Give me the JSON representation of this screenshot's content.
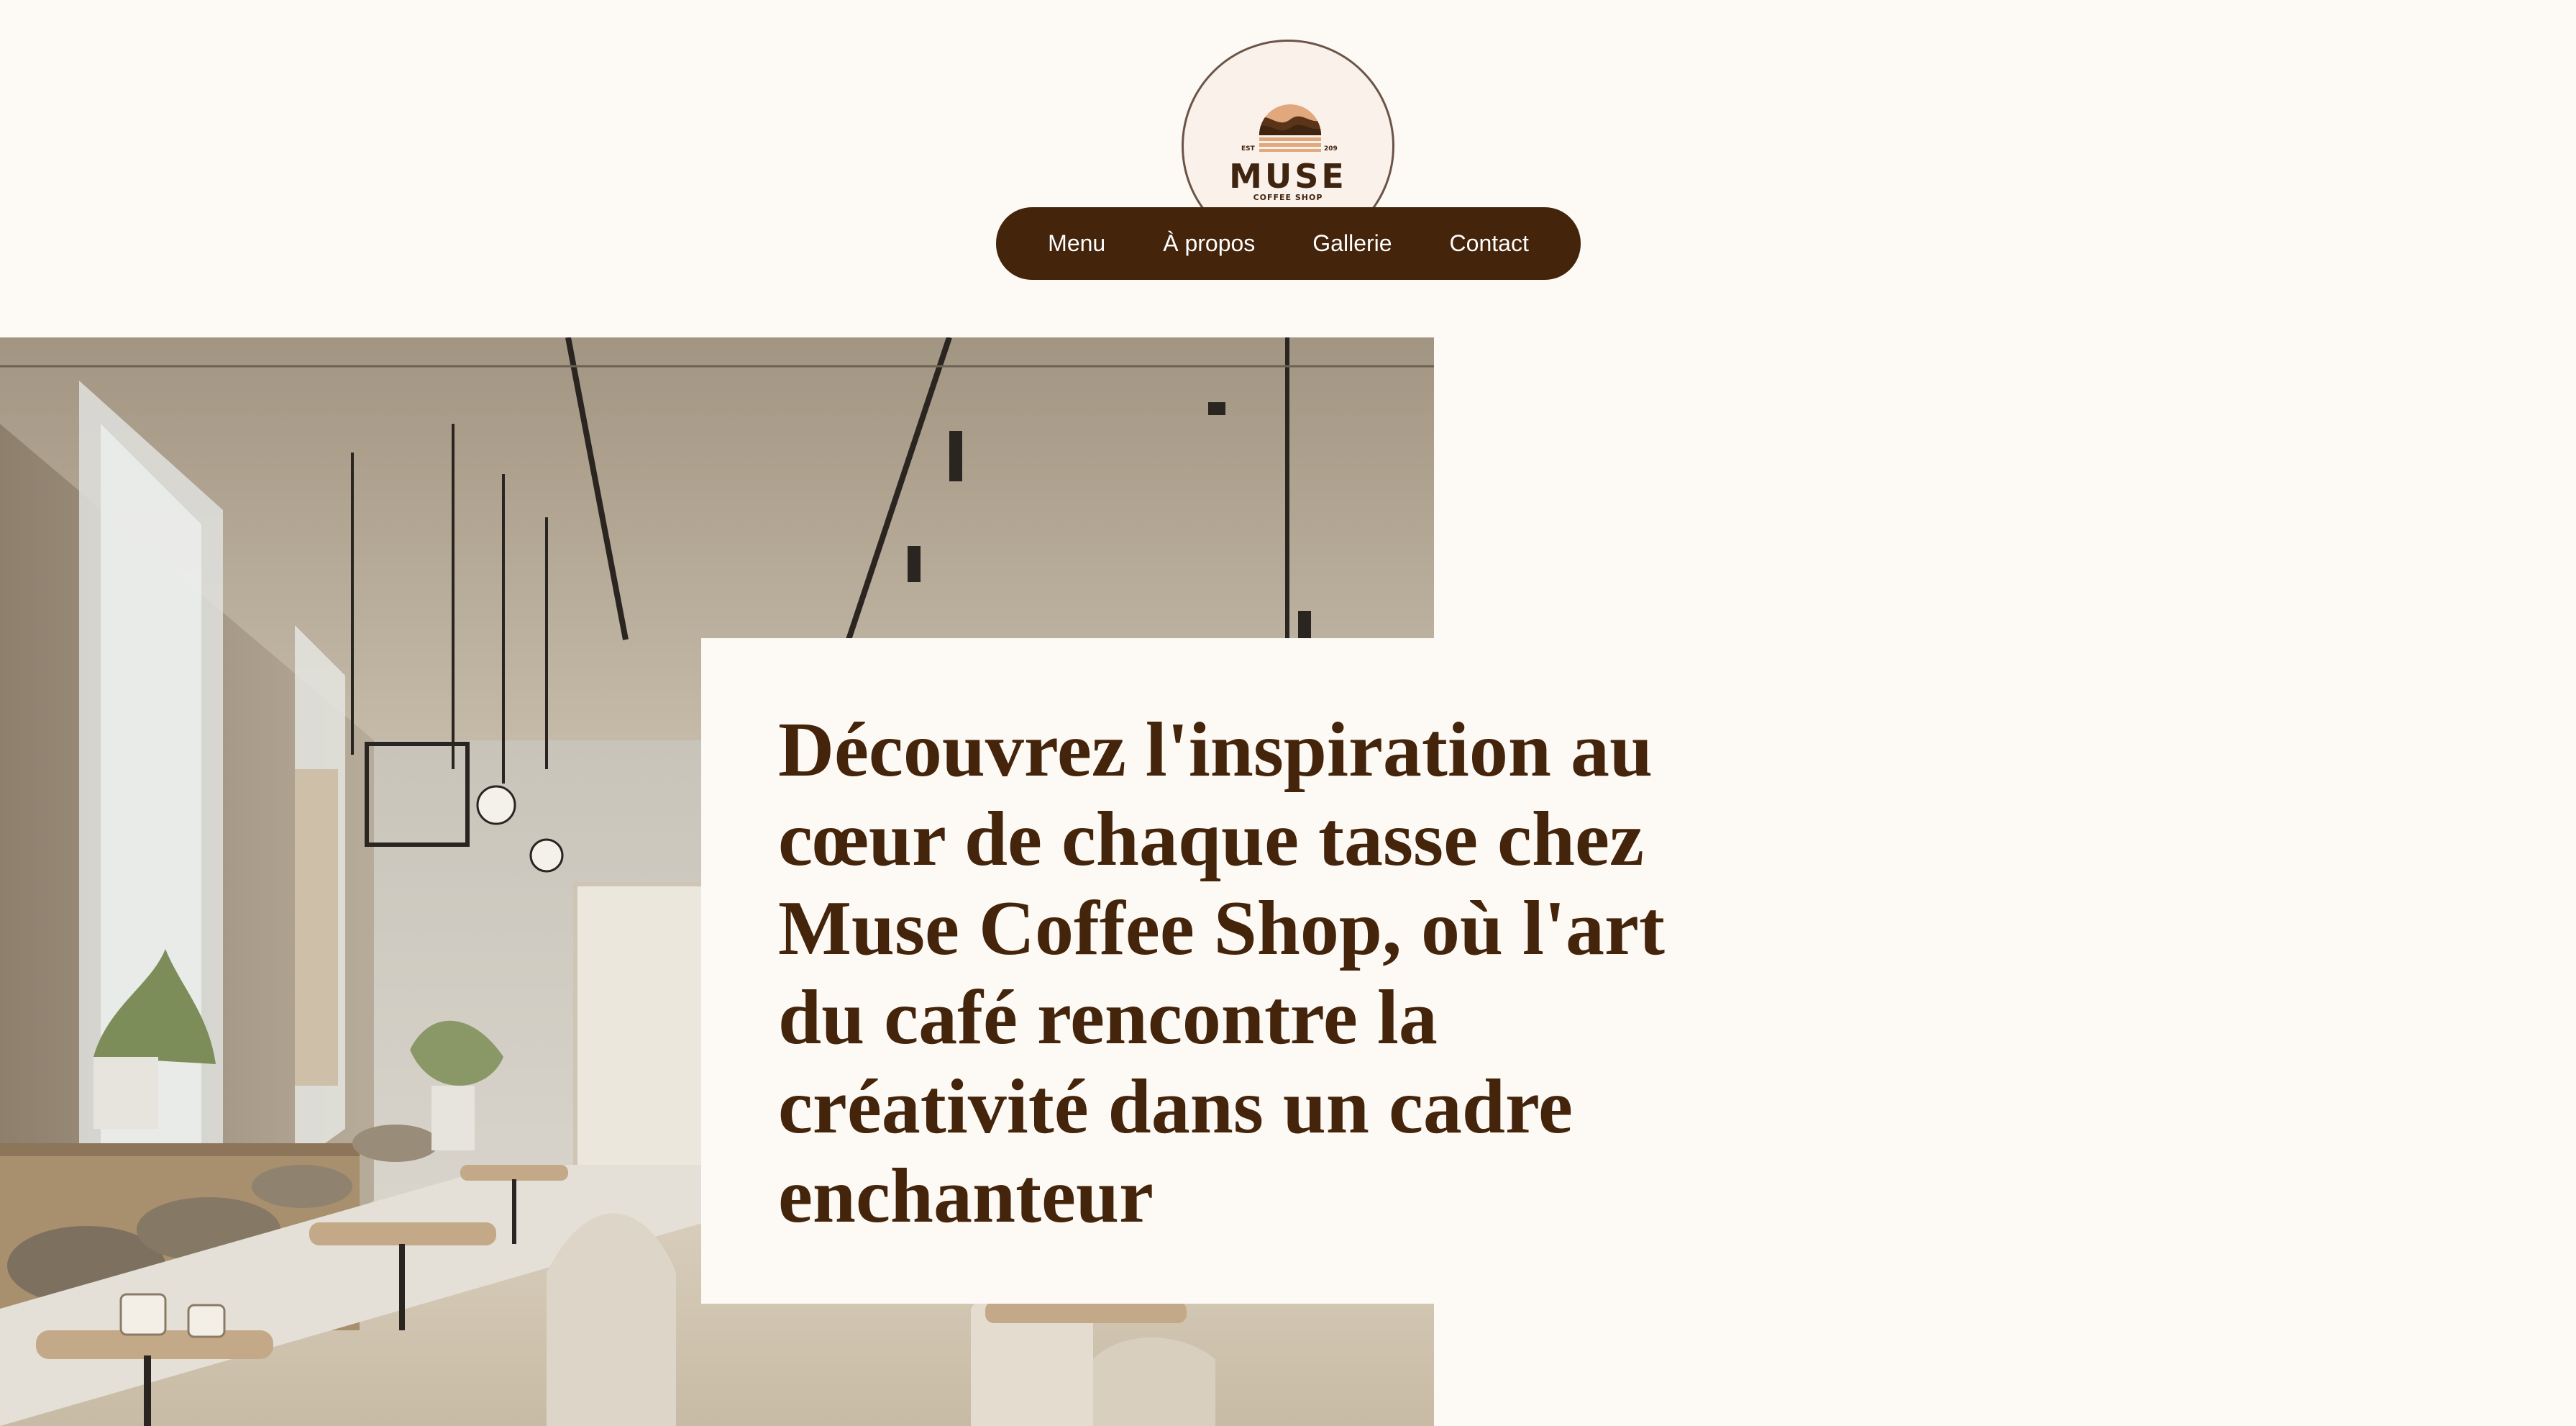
{
  "logo": {
    "name": "MUSE",
    "subtitle": "COFFEE SHOP",
    "est_left": "EST",
    "est_right": "209",
    "icon": "coffee-bean-sunrise-logo"
  },
  "nav": {
    "items": [
      {
        "label": "Menu"
      },
      {
        "label": "À propos"
      },
      {
        "label": "Gallerie"
      },
      {
        "label": "Contact"
      }
    ]
  },
  "hero": {
    "image": "cafe-interior-photo",
    "heading": "Découvrez l'inspiration au cœur de chaque tasse chez Muse Coffee Shop, où l'art du café rencontre la créativité dans un cadre enchanteur"
  },
  "colors": {
    "background": "#fdfaf5",
    "brand_dark": "#44240b",
    "logo_bg": "#faf1ea"
  }
}
